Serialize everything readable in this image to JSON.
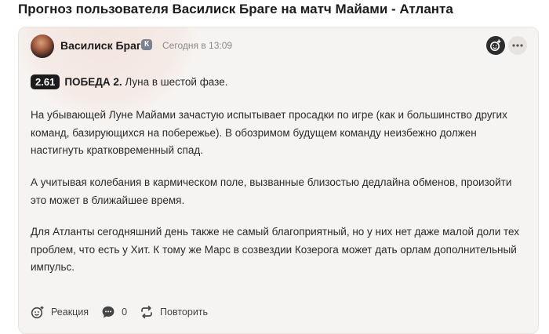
{
  "page": {
    "title": "Прогноз пользователя Василиск Браге на матч Майами - Атланта"
  },
  "post": {
    "author": "Василиск Браге",
    "author_badge": "К",
    "time": "Сегодня в 13:09",
    "odds": "2.61",
    "outcome": "ПОБЕДА 2.",
    "outcome_note": "Луна в шестой фазе.",
    "paragraphs": [
      "На убывающей Луне Майами зачастую испытывает просадки по игре (как и большинство других команд, базирующихся на побережье). В обозримом будущем команду неизбежно должен настигнуть кратковременный спад.",
      "А учитывая колебания в кармическом поле, вызванные близостью дедлайна обменов, произойти это может в ближайшее время.",
      "Для Атланты сегодняшний день также не самый благоприятный, но у них нет даже малой доли тех проблем, что есть у Хит. К тому же Марс в созвездии Козерога может дать орлам дополнительный импульс."
    ]
  },
  "actions": {
    "reaction_label": "Реакция",
    "comments_count": "0",
    "repost_label": "Повторить"
  },
  "icons": {
    "add": "add-reaction-icon",
    "more": "more-options-icon",
    "reaction": "reaction-smile-icon",
    "comment": "comment-bubble-icon",
    "repost": "repost-arrows-icon"
  },
  "colors": {
    "card_bg": "#f6f4f2",
    "odds_bg": "#1c1c1c",
    "text": "#2a2a2a"
  }
}
